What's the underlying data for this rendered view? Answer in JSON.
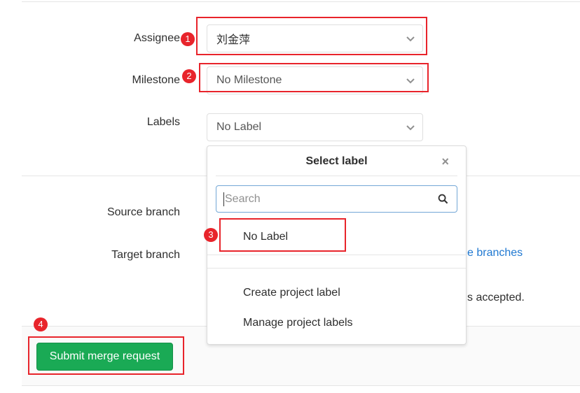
{
  "form": {
    "assignee_label": "Assignee",
    "assignee_value": "刘金萍",
    "milestone_label": "Milestone",
    "milestone_value": "No Milestone",
    "labels_label": "Labels",
    "labels_value": "No Label",
    "source_branch_label": "Source branch",
    "target_branch_label": "Target branch",
    "branches_link_partial": "e branches",
    "accepted_partial": "s accepted.",
    "submit_label": "Submit merge request"
  },
  "label_dropdown": {
    "title": "Select label",
    "close_glyph": "×",
    "search_placeholder": "Search",
    "no_label_option": "No Label",
    "create_label": "Create project label",
    "manage_labels": "Manage project labels"
  },
  "annotations": [
    "1",
    "2",
    "3",
    "4"
  ],
  "colors": {
    "highlight": "#e8242b",
    "submit": "#1aaa55",
    "link": "#1f78d1"
  }
}
